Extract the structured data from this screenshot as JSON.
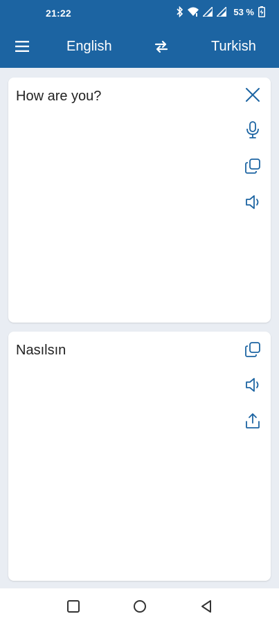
{
  "status_bar": {
    "time": "21:22",
    "battery": "53 %",
    "icons": [
      "bluetooth-icon",
      "wifi-icon",
      "signal-icon",
      "signal-icon",
      "battery-icon"
    ]
  },
  "toolbar": {
    "menu_icon": "hamburger-menu-icon",
    "source_language": "English",
    "swap_icon": "swap-arrows-icon",
    "target_language": "Turkish",
    "background_color": "#1c64a2"
  },
  "input_card": {
    "text": "How are you?",
    "actions": [
      "close-icon",
      "microphone-icon",
      "copy-icon",
      "speaker-icon"
    ]
  },
  "output_card": {
    "text": "Nasılsın",
    "actions": [
      "copy-icon",
      "speaker-icon",
      "share-icon"
    ]
  },
  "nav_bar": {
    "buttons": [
      "recents-square-icon",
      "home-circle-icon",
      "back-triangle-icon"
    ]
  },
  "colors": {
    "accent": "#1c64a2",
    "icon": "#1c64a2",
    "background": "#e9edf3",
    "card": "#ffffff"
  }
}
